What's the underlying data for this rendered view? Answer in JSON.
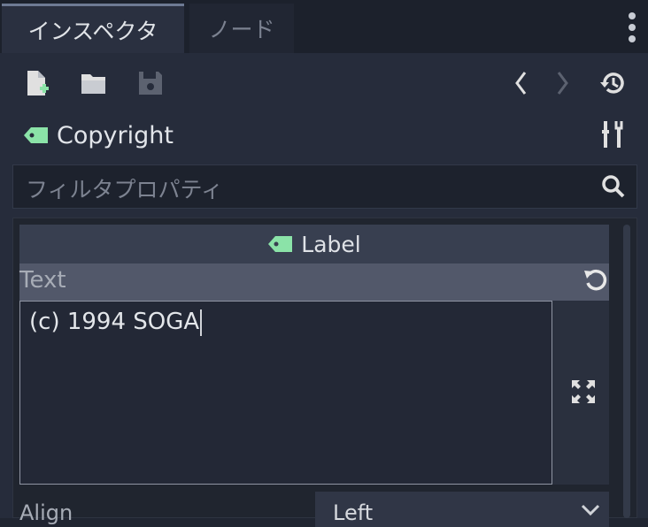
{
  "tabs": [
    {
      "label": "インスペクタ",
      "active": true
    },
    {
      "label": "ノード",
      "active": false
    }
  ],
  "object": {
    "name": "Copyright"
  },
  "filter": {
    "placeholder": "フィルタプロパティ"
  },
  "section": {
    "title": "Label"
  },
  "properties": {
    "text": {
      "label": "Text",
      "value": "(c) 1994 SOGA"
    },
    "align": {
      "label": "Align",
      "value": "Left"
    }
  },
  "colors": {
    "accent_green": "#8be3a8",
    "icon_gray": "#e0e0e0",
    "disabled_icon": "#5c6270"
  }
}
